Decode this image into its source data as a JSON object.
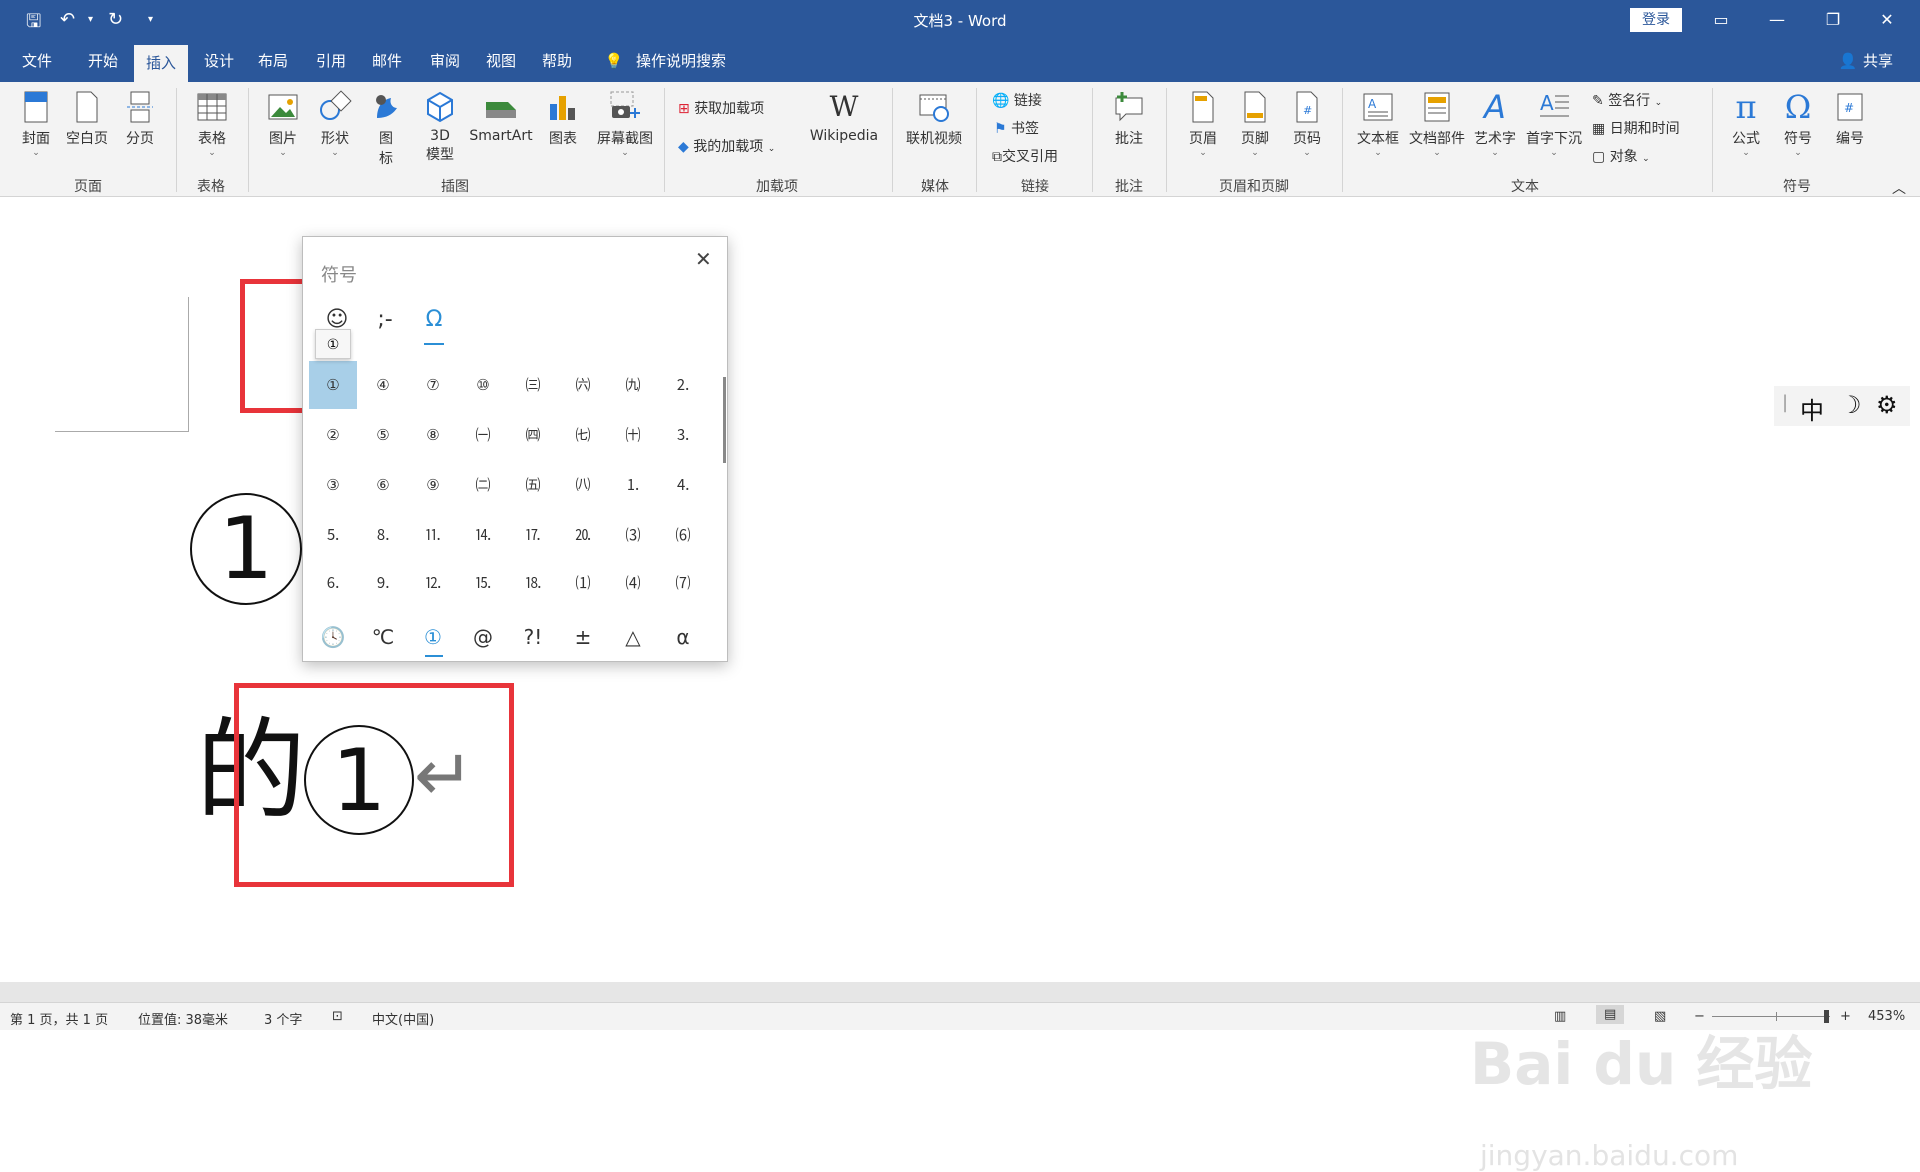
{
  "titlebar": {
    "title": "文档3 - Word",
    "login": "登录"
  },
  "tabs": [
    "文件",
    "开始",
    "插入",
    "设计",
    "布局",
    "引用",
    "邮件",
    "审阅",
    "视图",
    "帮助"
  ],
  "tellme": "操作说明搜索",
  "share": "共享",
  "ribbon": {
    "pages": {
      "cover": "封面",
      "blank": "空白页",
      "break": "分页",
      "group": "页面"
    },
    "table": {
      "table": "表格",
      "group": "表格"
    },
    "illus": {
      "pic": "图片",
      "shape": "形状",
      "icon_a": "图",
      "icon_b": "标",
      "model_a": "3D",
      "model_b": "模型",
      "smartart": "SmartArt",
      "chart": "图表",
      "screenshot": "屏幕截图",
      "group": "插图"
    },
    "addins": {
      "get": "获取加载项",
      "mine": "我的加载项",
      "wiki": "Wikipedia",
      "group": "加载项"
    },
    "media": {
      "video": "联机视频",
      "group": "媒体"
    },
    "links": {
      "link": "链接",
      "bookmark": "书签",
      "xref": "交叉引用",
      "group": "链接"
    },
    "comments": {
      "comment": "批注",
      "group": "批注"
    },
    "hf": {
      "header": "页眉",
      "footer": "页脚",
      "pageno": "页码",
      "group": "页眉和页脚"
    },
    "text": {
      "textbox": "文本框",
      "parts": "文档部件",
      "wordart": "艺术字",
      "dropcap": "首字下沉",
      "sigline": "签名行",
      "datetime": "日期和时间",
      "object": "对象",
      "group": "文本"
    },
    "symbols": {
      "equation": "公式",
      "symbol": "符号",
      "number": "编号",
      "group": "符号"
    }
  },
  "document": {
    "circled_one": "①",
    "text_line": "的①",
    "para_mark": "↵"
  },
  "symbol_panel": {
    "title": "符号",
    "tooltip": "①",
    "categories": [
      "☺",
      ";-",
      "Ω"
    ],
    "grid": [
      [
        "①",
        "④",
        "⑦",
        "⑩",
        "㈢",
        "㈥",
        "㈨",
        "⒉"
      ],
      [
        "②",
        "⑤",
        "⑧",
        "㈠",
        "㈣",
        "㈦",
        "㈩",
        "⒊"
      ],
      [
        "③",
        "⑥",
        "⑨",
        "㈡",
        "㈤",
        "㈧",
        "⒈",
        "⒋"
      ],
      [
        "⒌",
        "⒏",
        "⒒",
        "⒕",
        "⒘",
        "⒛",
        "⑶",
        "⑹"
      ],
      [
        "⒍",
        "⒐",
        "⒓",
        "⒖",
        "⒙",
        "⑴",
        "⑷",
        "⑺"
      ]
    ],
    "bottom": [
      "🕓",
      "℃",
      "①",
      "@",
      "?!",
      "±",
      "△",
      "α"
    ]
  },
  "ime": {
    "mode": "中",
    "moon": "☽",
    "gear": "⚙"
  },
  "status": {
    "page": "第 1 页，共 1 页",
    "position": "位置值: 38毫米",
    "words": "3 个字",
    "lang": "中文(中国)",
    "zoom": "453%"
  },
  "watermark": {
    "brand": "Bai du 经验",
    "url": "jingyan.baidu.com"
  }
}
